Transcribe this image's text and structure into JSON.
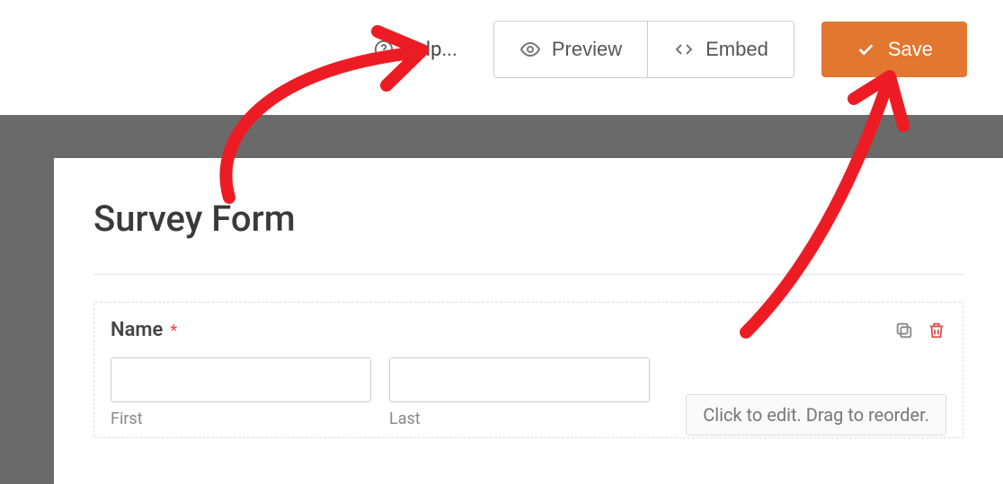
{
  "toolbar": {
    "help_label": "Help...",
    "preview_label": "Preview",
    "embed_label": "Embed",
    "save_label": "Save"
  },
  "form": {
    "title": "Survey Form",
    "name_field": {
      "label": "Name",
      "required_marker": "*",
      "first_value": "",
      "first_sublabel": "First",
      "last_value": "",
      "last_sublabel": "Last"
    },
    "hint_text": "Click to edit. Drag to reorder."
  },
  "colors": {
    "accent": "#e27730",
    "danger": "#d9534f"
  }
}
